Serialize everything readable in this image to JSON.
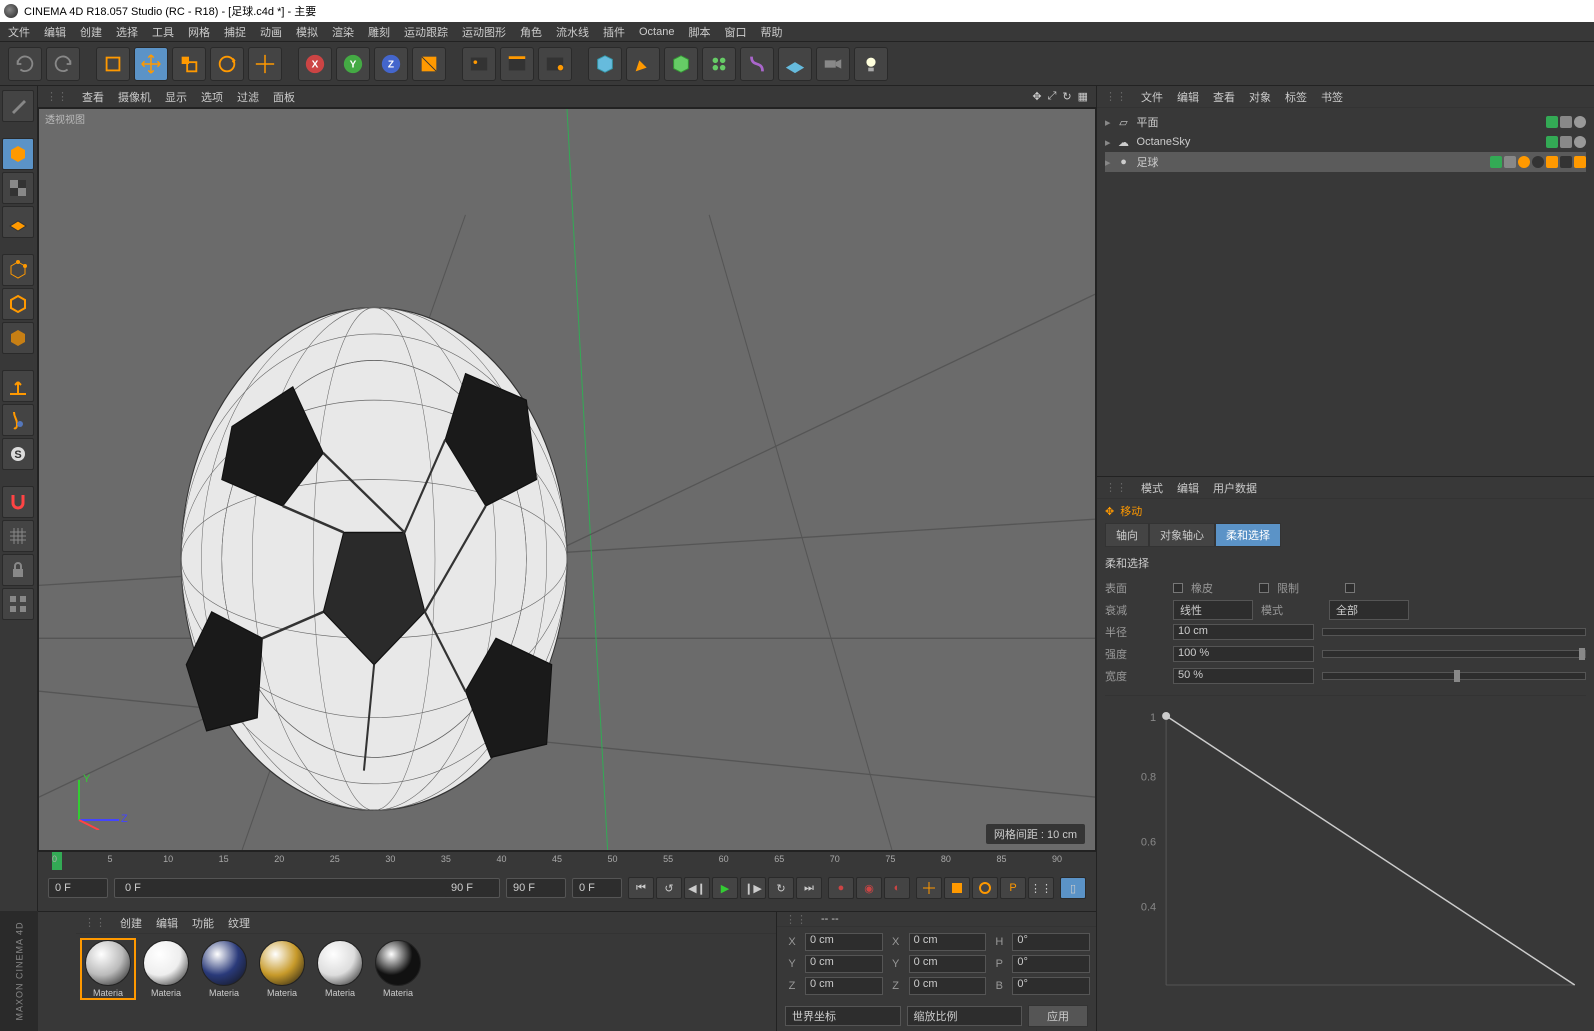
{
  "title": "CINEMA 4D R18.057 Studio (RC - R18) - [足球.c4d *] - 主要",
  "menu": [
    "文件",
    "编辑",
    "创建",
    "选择",
    "工具",
    "网格",
    "捕捉",
    "动画",
    "模拟",
    "渲染",
    "雕刻",
    "运动跟踪",
    "运动图形",
    "角色",
    "流水线",
    "插件",
    "Octane",
    "脚本",
    "窗口",
    "帮助"
  ],
  "view_menu": [
    "查看",
    "摄像机",
    "显示",
    "选项",
    "过滤",
    "面板"
  ],
  "viewport_label": "透视视图",
  "grid_info": "网格间距 : 10 cm",
  "timeline": {
    "start": "0 F",
    "end": "90 F",
    "cur": "0 F",
    "far": "0 F",
    "ticks": [
      0,
      5,
      10,
      15,
      20,
      25,
      30,
      35,
      40,
      45,
      50,
      55,
      60,
      65,
      70,
      75,
      80,
      85,
      90
    ]
  },
  "mat_menu": [
    "创建",
    "编辑",
    "功能",
    "纹理"
  ],
  "materials": [
    "Materia",
    "Materia",
    "Materia",
    "Materia",
    "Materia",
    "Materia"
  ],
  "mat_colors": [
    "#bbb",
    "#eee",
    "#2a3a7a",
    "#c79a2a",
    "#ddd",
    "#111"
  ],
  "coord_hdr": "--                 --",
  "coord": {
    "rows": [
      {
        "a": "X",
        "av": "0 cm",
        "b": "X",
        "bv": "0 cm",
        "c": "H",
        "cv": "0°"
      },
      {
        "a": "Y",
        "av": "0 cm",
        "b": "Y",
        "bv": "0 cm",
        "c": "P",
        "cv": "0°"
      },
      {
        "a": "Z",
        "av": "0 cm",
        "b": "Z",
        "bv": "0 cm",
        "c": "B",
        "cv": "0°"
      }
    ],
    "sys": "世界坐标",
    "scale": "缩放比例",
    "apply": "应用"
  },
  "obj_menu": [
    "文件",
    "编辑",
    "查看",
    "对象",
    "标签",
    "书签"
  ],
  "objects": [
    {
      "name": "平面",
      "icon": "plane",
      "sel": false
    },
    {
      "name": "OctaneSky",
      "icon": "sky",
      "sel": false
    },
    {
      "name": "足球",
      "icon": "ball",
      "sel": true
    }
  ],
  "attr_menu": [
    "模式",
    "编辑",
    "用户数据"
  ],
  "attr_title": "移动",
  "attr_tabs": [
    "轴向",
    "对象轴心",
    "柔和选择"
  ],
  "attr_sel": 2,
  "soft_section": "柔和选择",
  "soft_rows": [
    {
      "l": "表面",
      "t": "chk",
      "l2": "橡皮",
      "l3": "限制"
    },
    {
      "l": "衰减",
      "v": "线性",
      "l2": "模式",
      "v2": "全部"
    },
    {
      "l": "半径",
      "v": "10 cm"
    },
    {
      "l": "强度",
      "v": "100 %"
    },
    {
      "l": "宽度",
      "v": "50 %"
    }
  ],
  "graph_ticks": [
    "1",
    "0.8",
    "0.6",
    "0.4"
  ],
  "brand": "MAXON CINEMA 4D"
}
